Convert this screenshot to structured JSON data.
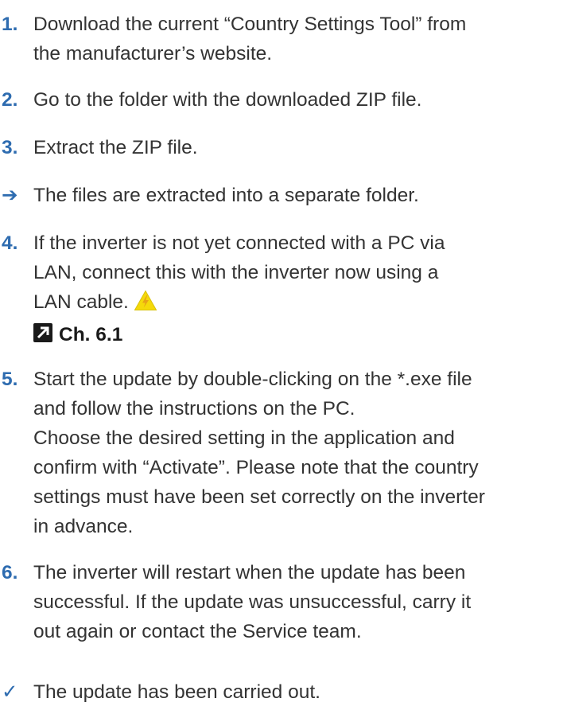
{
  "steps": [
    {
      "marker": "1.",
      "lines": [
        "Download the current “Country Settings Tool” from",
        "the manufacturer’s website."
      ]
    },
    {
      "marker": "2.",
      "lines": [
        "Go to the folder with the downloaded ZIP file."
      ]
    },
    {
      "marker": "3.",
      "lines": [
        "Extract the ZIP file."
      ]
    },
    {
      "marker": "➔",
      "lines": [
        "The files are extracted into a separate folder."
      ]
    },
    {
      "marker": "4.",
      "lines": [
        "If the inverter is not yet connected with a PC via",
        "LAN, connect this with the inverter now using a",
        "LAN cable."
      ],
      "reference": "Ch. 6.1"
    },
    {
      "marker": "5.",
      "lines": [
        "Start the update by double-clicking on the *.exe file",
        "and follow the instructions on the PC.",
        "Choose the desired setting in the application and",
        "confirm with “Activate”. Please note that the country",
        "settings must have been set correctly on the inverter",
        "in advance."
      ]
    },
    {
      "marker": "6.",
      "lines": [
        "The inverter will restart when the update has been",
        "successful. If the update was unsuccessful, carry it",
        "out again or contact the Service team."
      ]
    },
    {
      "marker": "✓",
      "lines": [
        "The update has been carried out."
      ]
    }
  ],
  "colors": {
    "accent": "#2e6cb0",
    "text": "#333333",
    "warning_fill": "#f5d90a",
    "warning_bolt": "#e8a317"
  },
  "icons": {
    "warning": "electrical-hazard-warning-icon",
    "reference": "cross-reference-arrow-icon",
    "result_arrow": "result-arrow-icon",
    "done": "checkmark-icon"
  }
}
